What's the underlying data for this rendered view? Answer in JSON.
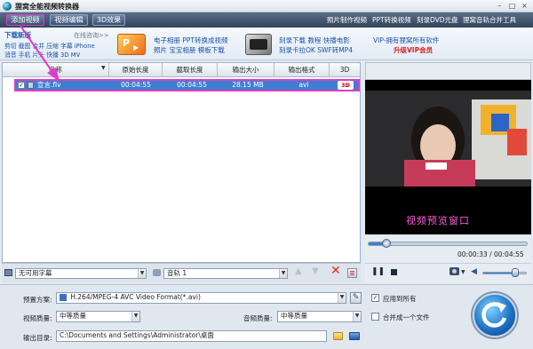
{
  "titlebar": {
    "title": "狸窝全能视频转换器"
  },
  "toolbar": {
    "add_video": "添加视频",
    "video_edit": "视频编辑",
    "effect_3d": "3D效果",
    "links": [
      "照片制作视频",
      "PPT转换视频",
      "刻录DVD光盘",
      "狸窝音轨合并工具"
    ]
  },
  "banner": {
    "download_title": "下载新版",
    "online_help": "在线咨询>>",
    "features_line1": "剪切 截图 合并 压缩 字幕 iPhone",
    "features_line2": "消音 手机 片头 快播 3D MV",
    "promo_ppt_line1": "电子相册 PPT转换成视频",
    "promo_ppt_line2": "照片 宝宝相册 模板下载",
    "promo_kara_line1": "刻录下载 教程 快播电影",
    "promo_kara_line2": "刻录卡拉OK SWF转MP4",
    "vip_line1": "VIP-拥有狸窝所有软件",
    "vip_line2": "升级VIP会员"
  },
  "list": {
    "columns": [
      "名称",
      "原始长度",
      "截取长度",
      "输出大小",
      "输出格式",
      "3D"
    ],
    "rows": [
      {
        "name": "宣言.flv",
        "original_length": "00:04:55",
        "clip_length": "00:04:55",
        "output_size": "28.15 MB",
        "output_format": "avi",
        "badge_3d": "3D",
        "checked": true
      }
    ]
  },
  "listfoot": {
    "subtitle": "无可用字幕",
    "audio": "音轨 1"
  },
  "preview": {
    "overlay_text": "视频预览窗口",
    "time": "00:00:33 / 00:04:55",
    "progress_fraction": 0.11,
    "volume_fraction": 0.75
  },
  "settings": {
    "preset_label": "预置方案:",
    "preset_value": "H.264/MPEG-4 AVC Video Format(*.avi)",
    "apply_all": "应用到所有",
    "video_quality_label": "视频质量:",
    "video_quality_value": "中等质量",
    "audio_quality_label": "音频质量:",
    "audio_quality_value": "中等质量",
    "merge_label": "合并成一个文件",
    "output_label": "输出目录:",
    "output_value": "C:\\Documents and Settings\\Administrator\\桌面"
  },
  "colors": {
    "toolbar": "#3b4f68",
    "selection": "#3d7fd0",
    "highlight": "#e03ac8",
    "promo_link": "#1b52a8",
    "vip": "#d8201f"
  }
}
